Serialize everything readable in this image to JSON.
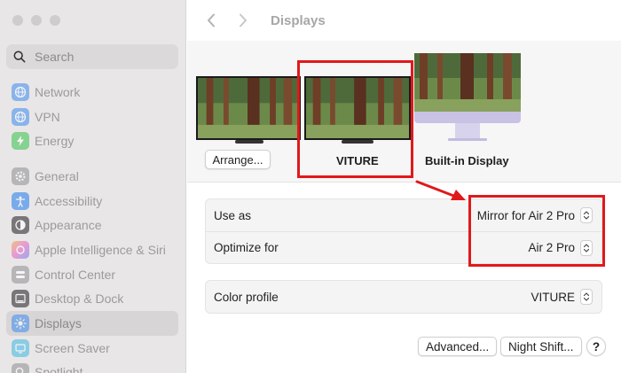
{
  "window": {
    "title": "Displays"
  },
  "sidebar": {
    "search_placeholder": "Search",
    "groups": [
      [
        {
          "label": "Network",
          "icon": "globe-icon",
          "color": "#3b8cf0"
        },
        {
          "label": "VPN",
          "icon": "vpn-globe-icon",
          "color": "#3b8cf0"
        },
        {
          "label": "Energy",
          "icon": "bolt-icon",
          "color": "#36c24a"
        }
      ],
      [
        {
          "label": "General",
          "icon": "gear-icon",
          "color": "#8e8e93"
        },
        {
          "label": "Accessibility",
          "icon": "accessibility-icon",
          "color": "#1f7cf0"
        },
        {
          "label": "Appearance",
          "icon": "appearance-icon",
          "color": "#1c1c1e"
        },
        {
          "label": "Apple Intelligence & Siri",
          "icon": "siri-icon",
          "color": "#e35cc6"
        },
        {
          "label": "Control Center",
          "icon": "control-center-icon",
          "color": "#8e8e93"
        },
        {
          "label": "Desktop & Dock",
          "icon": "dock-icon",
          "color": "#1c1c1e"
        },
        {
          "label": "Displays",
          "icon": "sun-icon",
          "color": "#3b8cf0",
          "active": true
        },
        {
          "label": "Screen Saver",
          "icon": "screen-saver-icon",
          "color": "#3bb8e0"
        },
        {
          "label": "Spotlight",
          "icon": "spotlight-icon",
          "color": "#8e8e93"
        }
      ]
    ]
  },
  "displays": {
    "arrange_label": "Arrange...",
    "viture_label": "VITURE",
    "builtin_label": "Built-in Display"
  },
  "settings": {
    "rows": [
      {
        "label": "Use as",
        "value": "Mirror for Air 2 Pro"
      },
      {
        "label": "Optimize for",
        "value": "Air 2 Pro"
      }
    ],
    "color_profile": {
      "label": "Color profile",
      "value": "VITURE"
    }
  },
  "footer": {
    "advanced_label": "Advanced...",
    "night_shift_label": "Night Shift...",
    "help_label": "?"
  },
  "colors": {
    "annotation": "#e0191b",
    "accent": "#3b8cf0"
  }
}
